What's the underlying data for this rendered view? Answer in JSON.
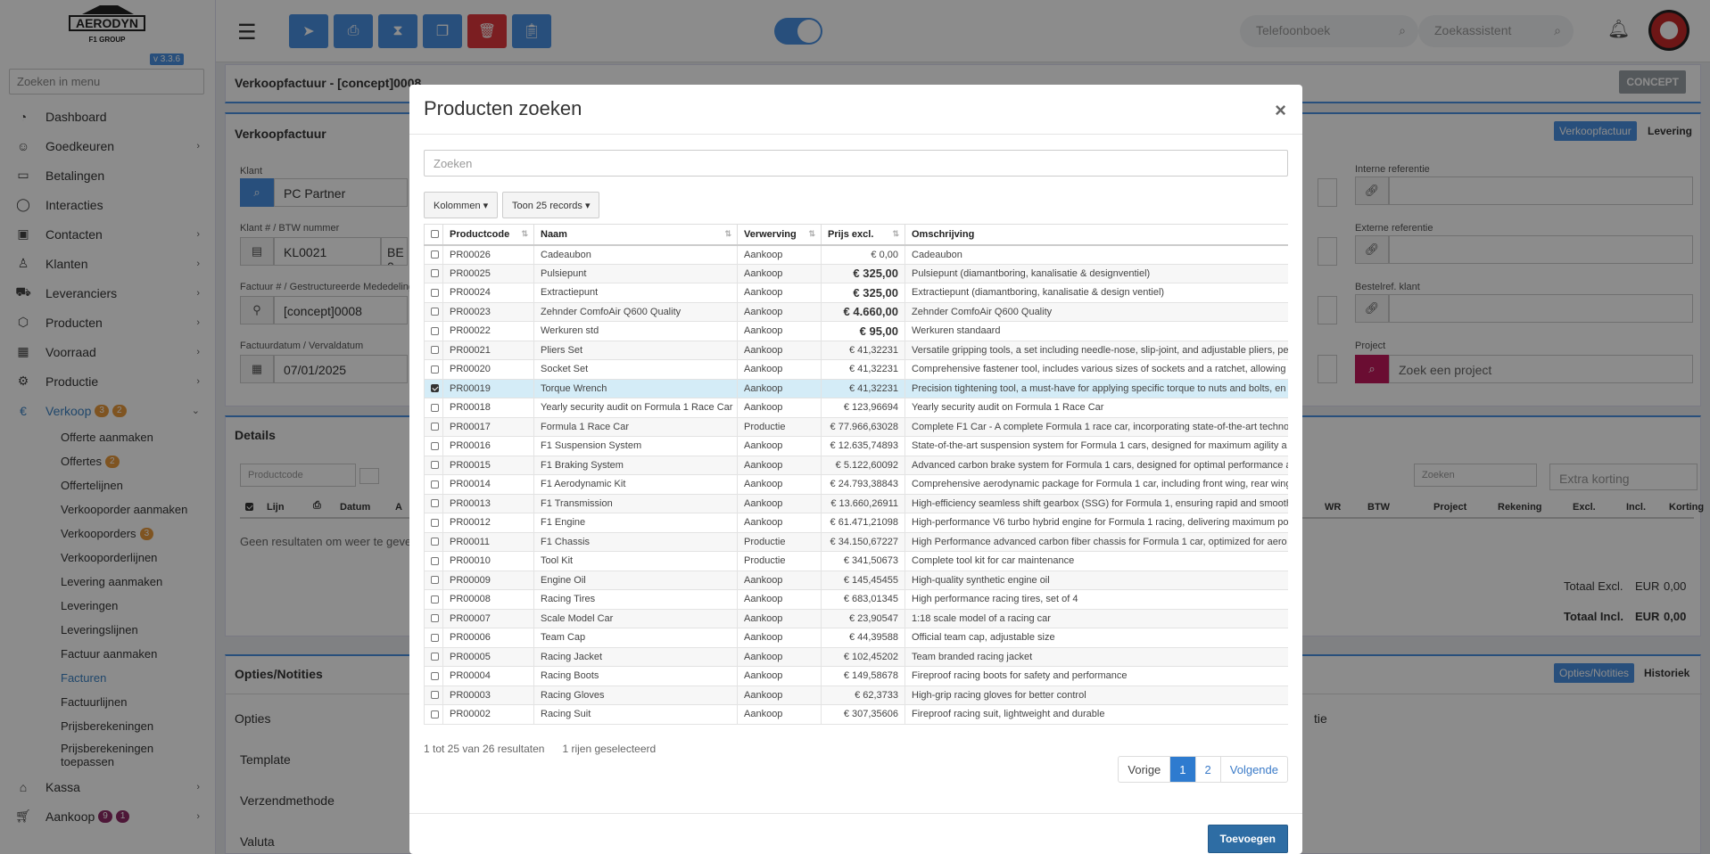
{
  "brand": {
    "name": "AERODYN",
    "group": "F1 GROUP",
    "version": "v 3.3.6"
  },
  "sidebar": {
    "search_placeholder": "Zoeken in menu",
    "items": [
      {
        "label": "Dashboard",
        "icon": "gauge-icon",
        "chevron": false
      },
      {
        "label": "Goedkeuren",
        "icon": "user-check-icon",
        "chevron": true
      },
      {
        "label": "Betalingen",
        "icon": "card-icon",
        "chevron": false
      },
      {
        "label": "Interacties",
        "icon": "chat-icon",
        "chevron": false
      },
      {
        "label": "Contacten",
        "icon": "contact-card-icon",
        "chevron": true
      },
      {
        "label": "Klanten",
        "icon": "user-icon",
        "chevron": true
      },
      {
        "label": "Leveranciers",
        "icon": "truck-icon",
        "chevron": true
      },
      {
        "label": "Producten",
        "icon": "box-icon",
        "chevron": true
      },
      {
        "label": "Voorraad",
        "icon": "boxes-icon",
        "chevron": true
      },
      {
        "label": "Productie",
        "icon": "cogs-icon",
        "chevron": true
      }
    ],
    "verkoop": {
      "label": "Verkoop",
      "badge1": "3",
      "badge2": "2"
    },
    "sub_items": [
      {
        "label": "Offerte aanmaken"
      },
      {
        "label": "Offertes",
        "badge": "2"
      },
      {
        "label": "Offertelijnen"
      },
      {
        "label": "Verkooporder aanmaken"
      },
      {
        "label": "Verkooporders",
        "badge": "3"
      },
      {
        "label": "Verkooporderlijnen"
      },
      {
        "label": "Levering aanmaken"
      },
      {
        "label": "Leveringen"
      },
      {
        "label": "Leveringslijnen"
      },
      {
        "label": "Factuur aanmaken"
      },
      {
        "label": "Facturen"
      },
      {
        "label": "Factuurlijnen"
      },
      {
        "label": "Prijsberekeningen"
      },
      {
        "label": "Prijsberekeningen toepassen"
      }
    ],
    "kassa": "Kassa",
    "aankoop": {
      "label": "Aankoop",
      "badge1": "9",
      "badge2": "1"
    }
  },
  "topbar": {
    "phonebook_placeholder": "Telefoonboek",
    "assistant_placeholder": "Zoekassistent"
  },
  "page": {
    "title": "Verkoopfactuur - [concept]0008",
    "status": "CONCEPT",
    "section_title": "Verkoopfactuur",
    "tab_active": "Verkoopfactuur",
    "tab_other": "Levering",
    "klant_label": "Klant",
    "klant_value": "PC Partner",
    "klantnr_label": "Klant # / BTW nummer",
    "klantnr_value": "KL0021",
    "btw_value": "BE 0",
    "factuurnr_label": "Factuur # / Gestructureerde Mededeling",
    "factuurnr_value": "[concept]0008",
    "datum_label": "Factuurdatum / Vervaldatum",
    "datum_value": "07/01/2025",
    "interne_ref_label": "Interne referentie",
    "externe_ref_label": "Externe referentie",
    "bestelref_label": "Bestelref. klant",
    "project_label": "Project",
    "project_placeholder": "Zoek een project",
    "details_title": "Details",
    "productcode_placeholder": "Productcode",
    "details_search_placeholder": "Zoeken",
    "extra_korting_placeholder": "Extra korting",
    "no_results": "Geen resultaten om weer te geven",
    "detail_cols_left": [
      "Lijn",
      "Datum",
      "A"
    ],
    "detail_cols_right": [
      "WR",
      "BTW",
      "Project",
      "Rekening",
      "Excl.",
      "Incl.",
      "Korting"
    ],
    "totaal_excl_label": "Totaal Excl.",
    "totaal_incl_label": "Totaal Incl.",
    "currency": "EUR",
    "totaal_excl": "0,00",
    "totaal_incl": "0,00",
    "opties_title": "Opties/Notities",
    "tab_opties": "Opties/Notities",
    "tab_historiek": "Historiek",
    "opties_sub": "Opties",
    "opties_right": "tie",
    "template_label": "Template",
    "verzend_label": "Verzendmethode",
    "valuta_label": "Valuta"
  },
  "modal": {
    "title": "Producten zoeken",
    "search_placeholder": "Zoeken",
    "kolommen_label": "Kolommen",
    "toon_label": "Toon 25 records",
    "columns": [
      "Productcode",
      "Naam",
      "Verwerving",
      "Prijs excl.",
      "Omschrijving"
    ],
    "rows": [
      {
        "code": "PR00026",
        "naam": "Cadeaubon",
        "verwerving": "Aankoop",
        "prijs": "€ 0,00",
        "bold": false,
        "omschrijving": "Cadeaubon",
        "selected": false
      },
      {
        "code": "PR00025",
        "naam": "Pulsiepunt",
        "verwerving": "Aankoop",
        "prijs": "€ 325,00",
        "bold": true,
        "omschrijving": "Pulsiepunt (diamantboring, kanalisatie & designventiel)",
        "selected": false
      },
      {
        "code": "PR00024",
        "naam": "Extractiepunt",
        "verwerving": "Aankoop",
        "prijs": "€ 325,00",
        "bold": true,
        "omschrijving": "Extractiepunt (diamantboring, kanalisatie & design ventiel)",
        "selected": false
      },
      {
        "code": "PR00023",
        "naam": "Zehnder ComfoAir Q600 Quality",
        "verwerving": "Aankoop",
        "prijs": "€ 4.660,00",
        "bold": true,
        "omschrijving": "Zehnder ComfoAir Q600 Quality",
        "selected": false
      },
      {
        "code": "PR00022",
        "naam": "Werkuren std",
        "verwerving": "Aankoop",
        "prijs": "€ 95,00",
        "bold": true,
        "omschrijving": "Werkuren standaard",
        "selected": false
      },
      {
        "code": "PR00021",
        "naam": "Pliers Set",
        "verwerving": "Aankoop",
        "prijs": "€ 41,32231",
        "bold": false,
        "omschrijving": "Versatile gripping tools, a set including needle-nose, slip-joint, and adjustable pliers, per",
        "selected": false
      },
      {
        "code": "PR00020",
        "naam": "Socket Set",
        "verwerving": "Aankoop",
        "prijs": "€ 41,32231",
        "bold": false,
        "omschrijving": "Comprehensive fastener tool, includes various sizes of sockets and a ratchet, allowing",
        "selected": false
      },
      {
        "code": "PR00019",
        "naam": "Torque Wrench",
        "verwerving": "Aankoop",
        "prijs": "€ 41,32231",
        "bold": false,
        "omschrijving": "Precision tightening tool, a must-have for applying specific torque to nuts and bolts, en",
        "selected": true
      },
      {
        "code": "PR00018",
        "naam": "Yearly security audit on Formula 1 Race Car",
        "verwerving": "Aankoop",
        "prijs": "€ 123,96694",
        "bold": false,
        "omschrijving": "Yearly security audit on Formula 1 Race Car",
        "selected": false
      },
      {
        "code": "PR00017",
        "naam": "Formula 1 Race Car",
        "verwerving": "Productie",
        "prijs": "€ 77.966,63028",
        "bold": false,
        "omschrijving": "Complete F1 Car - A complete Formula 1 race car, incorporating state-of-the-art techno",
        "selected": false
      },
      {
        "code": "PR00016",
        "naam": "F1 Suspension System",
        "verwerving": "Aankoop",
        "prijs": "€ 12.635,74893",
        "bold": false,
        "omschrijving": "State-of-the-art suspension system for Formula 1 cars, designed for maximum agility a",
        "selected": false
      },
      {
        "code": "PR00015",
        "naam": "F1 Braking System",
        "verwerving": "Aankoop",
        "prijs": "€ 5.122,60092",
        "bold": false,
        "omschrijving": "Advanced carbon brake system for Formula 1 cars, designed for optimal performance a",
        "selected": false
      },
      {
        "code": "PR00014",
        "naam": "F1 Aerodynamic Kit",
        "verwerving": "Aankoop",
        "prijs": "€ 24.793,38843",
        "bold": false,
        "omschrijving": "Comprehensive aerodynamic package for Formula 1 car, including front wing, rear wing",
        "selected": false
      },
      {
        "code": "PR00013",
        "naam": "F1 Transmission",
        "verwerving": "Aankoop",
        "prijs": "€ 13.660,26911",
        "bold": false,
        "omschrijving": "High-efficiency seamless shift gearbox (SSG) for Formula 1, ensuring rapid and smooth",
        "selected": false
      },
      {
        "code": "PR00012",
        "naam": "F1 Engine",
        "verwerving": "Aankoop",
        "prijs": "€ 61.471,21098",
        "bold": false,
        "omschrijving": "High-performance V6 turbo hybrid engine for Formula 1 racing, delivering maximum po",
        "selected": false
      },
      {
        "code": "PR00011",
        "naam": "F1 Chassis",
        "verwerving": "Productie",
        "prijs": "€ 34.150,67227",
        "bold": false,
        "omschrijving": "High Performance advanced carbon fiber chassis for Formula 1 car, optimized for aero",
        "selected": false
      },
      {
        "code": "PR00010",
        "naam": "Tool Kit",
        "verwerving": "Productie",
        "prijs": "€ 341,50673",
        "bold": false,
        "omschrijving": "Complete tool kit for car maintenance",
        "selected": false
      },
      {
        "code": "PR00009",
        "naam": "Engine Oil",
        "verwerving": "Aankoop",
        "prijs": "€ 145,45455",
        "bold": false,
        "omschrijving": "High-quality synthetic engine oil",
        "selected": false
      },
      {
        "code": "PR00008",
        "naam": "Racing Tires",
        "verwerving": "Aankoop",
        "prijs": "€ 683,01345",
        "bold": false,
        "omschrijving": "High performance racing tires, set of 4",
        "selected": false
      },
      {
        "code": "PR00007",
        "naam": "Scale Model Car",
        "verwerving": "Aankoop",
        "prijs": "€ 23,90547",
        "bold": false,
        "omschrijving": "1:18 scale model of a racing car",
        "selected": false
      },
      {
        "code": "PR00006",
        "naam": "Team Cap",
        "verwerving": "Aankoop",
        "prijs": "€ 44,39588",
        "bold": false,
        "omschrijving": "Official team cap, adjustable size",
        "selected": false
      },
      {
        "code": "PR00005",
        "naam": "Racing Jacket",
        "verwerving": "Aankoop",
        "prijs": "€ 102,45202",
        "bold": false,
        "omschrijving": "Team branded racing jacket",
        "selected": false
      },
      {
        "code": "PR00004",
        "naam": "Racing Boots",
        "verwerving": "Aankoop",
        "prijs": "€ 149,58678",
        "bold": false,
        "omschrijving": "Fireproof racing boots for safety and performance",
        "selected": false
      },
      {
        "code": "PR00003",
        "naam": "Racing Gloves",
        "verwerving": "Aankoop",
        "prijs": "€ 62,3733",
        "bold": false,
        "omschrijving": "High-grip racing gloves for better control",
        "selected": false
      },
      {
        "code": "PR00002",
        "naam": "Racing Suit",
        "verwerving": "Aankoop",
        "prijs": "€ 307,35606",
        "bold": false,
        "omschrijving": "Fireproof racing suit, lightweight and durable",
        "selected": false
      }
    ],
    "info_range": "1 tot 25 van 26 resultaten",
    "info_selected": "1 rijen geselecteerd",
    "pager": {
      "prev": "Vorige",
      "p1": "1",
      "p2": "2",
      "next": "Volgende"
    },
    "add_label": "Toevoegen"
  },
  "colors": {
    "accent": "#4a90e2",
    "danger": "#e0383c",
    "selected_row": "#d4ecf7"
  }
}
